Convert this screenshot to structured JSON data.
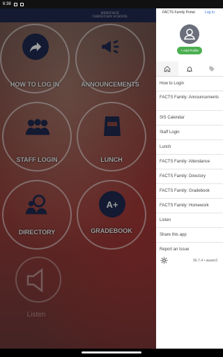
{
  "status_bar": {
    "time": "6:38"
  },
  "app": {
    "logo_lines": [
      "HERITAGE",
      "CHRISTIAN SCHOOL"
    ],
    "tiles": [
      {
        "key": "howto",
        "label": "HOW TO LOG IN",
        "icon": "share-arrow-icon"
      },
      {
        "key": "announce",
        "label": "ANNOUNCEMENTS",
        "icon": "megaphone-icon"
      },
      {
        "key": "stafflogin",
        "label": "STAFF LOGIN",
        "icon": "people-group-icon"
      },
      {
        "key": "lunch",
        "label": "LUNCH",
        "icon": "lunch-bag-icon"
      },
      {
        "key": "directory",
        "label": "DIRECTORY",
        "icon": "directory-search-icon"
      },
      {
        "key": "gradebook",
        "label": "GRADEBOOK",
        "icon": "grade-a-plus-icon",
        "icon_text": "A+"
      }
    ],
    "listen": {
      "label": "Listen",
      "icon": "speaker-icon"
    }
  },
  "drawer": {
    "title": "FACTS Family Portal",
    "login_label": "Log In",
    "avatar_icon": "person-icon",
    "add_profile_label": "Add Profile",
    "tabs": [
      {
        "icon": "home-icon",
        "active": true
      },
      {
        "icon": "bell-icon",
        "active": false
      },
      {
        "icon": "tag-icon",
        "active": false
      }
    ],
    "menu_items": [
      "How to Login",
      "FACTS Family: Announcements",
      "SIS Calendar",
      "Staff Login",
      "Lunch",
      "FACTS Family: Attendance",
      "FACTS Family: Directory",
      "FACTS Family: Gradebook",
      "FACTS Family: Homework",
      "Listen",
      "Share this app",
      "Report an Issue"
    ],
    "settings_icon": "gear-icon",
    "version": "56.7.4 • aware3"
  },
  "colors": {
    "navy": "#1f2a52",
    "accent_green": "#4caf50",
    "link_blue": "#2b6fd6"
  }
}
